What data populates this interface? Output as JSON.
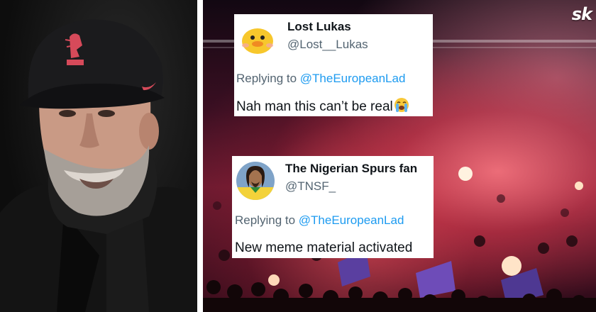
{
  "tweets": [
    {
      "name": "Lost Lukas",
      "handle": "@Lost__Lukas",
      "replying_prefix": "Replying to ",
      "replying_to": "@TheEuropeanLad",
      "text": "Nah man this can’t be real",
      "emoji": "loudly-crying-face",
      "avatar": "yellow-duck-emoji-avatar"
    },
    {
      "name": "The Nigerian Spurs fan",
      "handle": "@TNSF_",
      "replying_prefix": "Replying to ",
      "replying_to": "@TheEuropeanLad",
      "text": "New meme material activated",
      "avatar": "footballer-in-yellow-kit-avatar"
    }
  ],
  "watermark": "sk",
  "photos": {
    "left": "manager-in-black-cap-portrait",
    "right": "stadium-crowd-with-red-flares"
  },
  "colors": {
    "link": "#1d9bf0",
    "muted": "#536471",
    "text": "#0f1419",
    "flare": "#e8506a"
  }
}
